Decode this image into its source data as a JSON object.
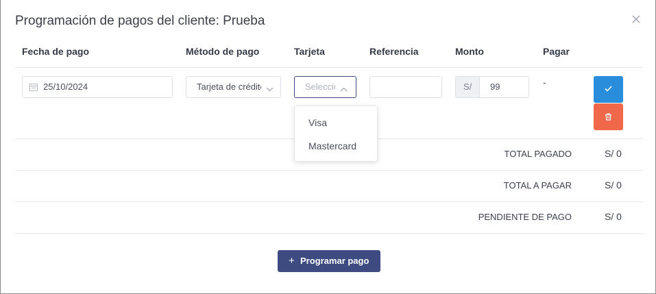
{
  "modal": {
    "title": "Programación de pagos del cliente: Prueba"
  },
  "table": {
    "headers": [
      "Fecha de pago",
      "Método de pago",
      "Tarjeta",
      "Referencia",
      "Monto",
      "Pagar"
    ],
    "row": {
      "date": "25/10/2024",
      "method": "Tarjeta de crédito",
      "card_placeholder": "Seleccionar",
      "reference": "",
      "currency_prefix": "S/",
      "amount": "99",
      "pay": "-"
    }
  },
  "card_dropdown": {
    "options": [
      "Visa",
      "Mastercard"
    ]
  },
  "summary": [
    {
      "label": "TOTAL PAGADO",
      "value": "S/ 0"
    },
    {
      "label": "TOTAL A PAGAR",
      "value": "S/ 0"
    },
    {
      "label": "PENDIENTE DE PAGO",
      "value": "S/ 0"
    }
  ],
  "actions": {
    "add_label": "Programar pago",
    "add_icon": "plus-icon",
    "confirm_icon": "check-icon",
    "delete_icon": "trash-icon"
  },
  "colors": {
    "primary": "#3d4b80",
    "confirm": "#2a8ddb",
    "delete": "#f0674a"
  }
}
